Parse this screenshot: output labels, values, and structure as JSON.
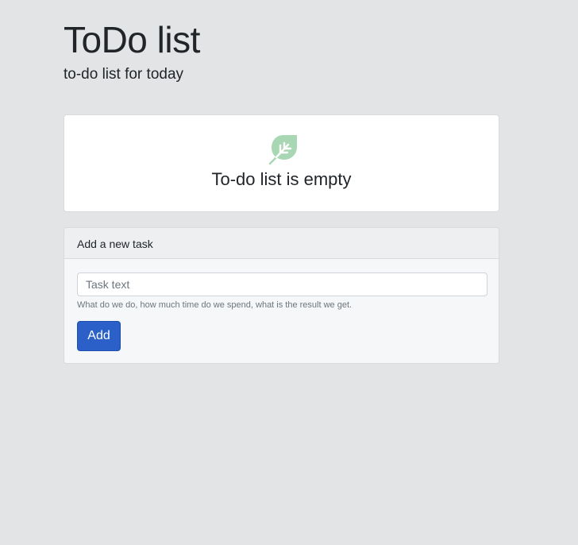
{
  "header": {
    "title": "ToDo list",
    "subtitle": "to-do list for today"
  },
  "empty_state": {
    "icon": "leaf-icon",
    "icon_color": "#a9d7b4",
    "message": "To-do list is empty"
  },
  "new_task": {
    "heading": "Add a new task",
    "input_value": "",
    "input_placeholder": "Task text",
    "help_text": "What do we do, how much time do we spend, what is the result we get.",
    "add_label": "Add"
  },
  "colors": {
    "background": "#e3e4e6",
    "primary_button": "#2a60c7"
  }
}
